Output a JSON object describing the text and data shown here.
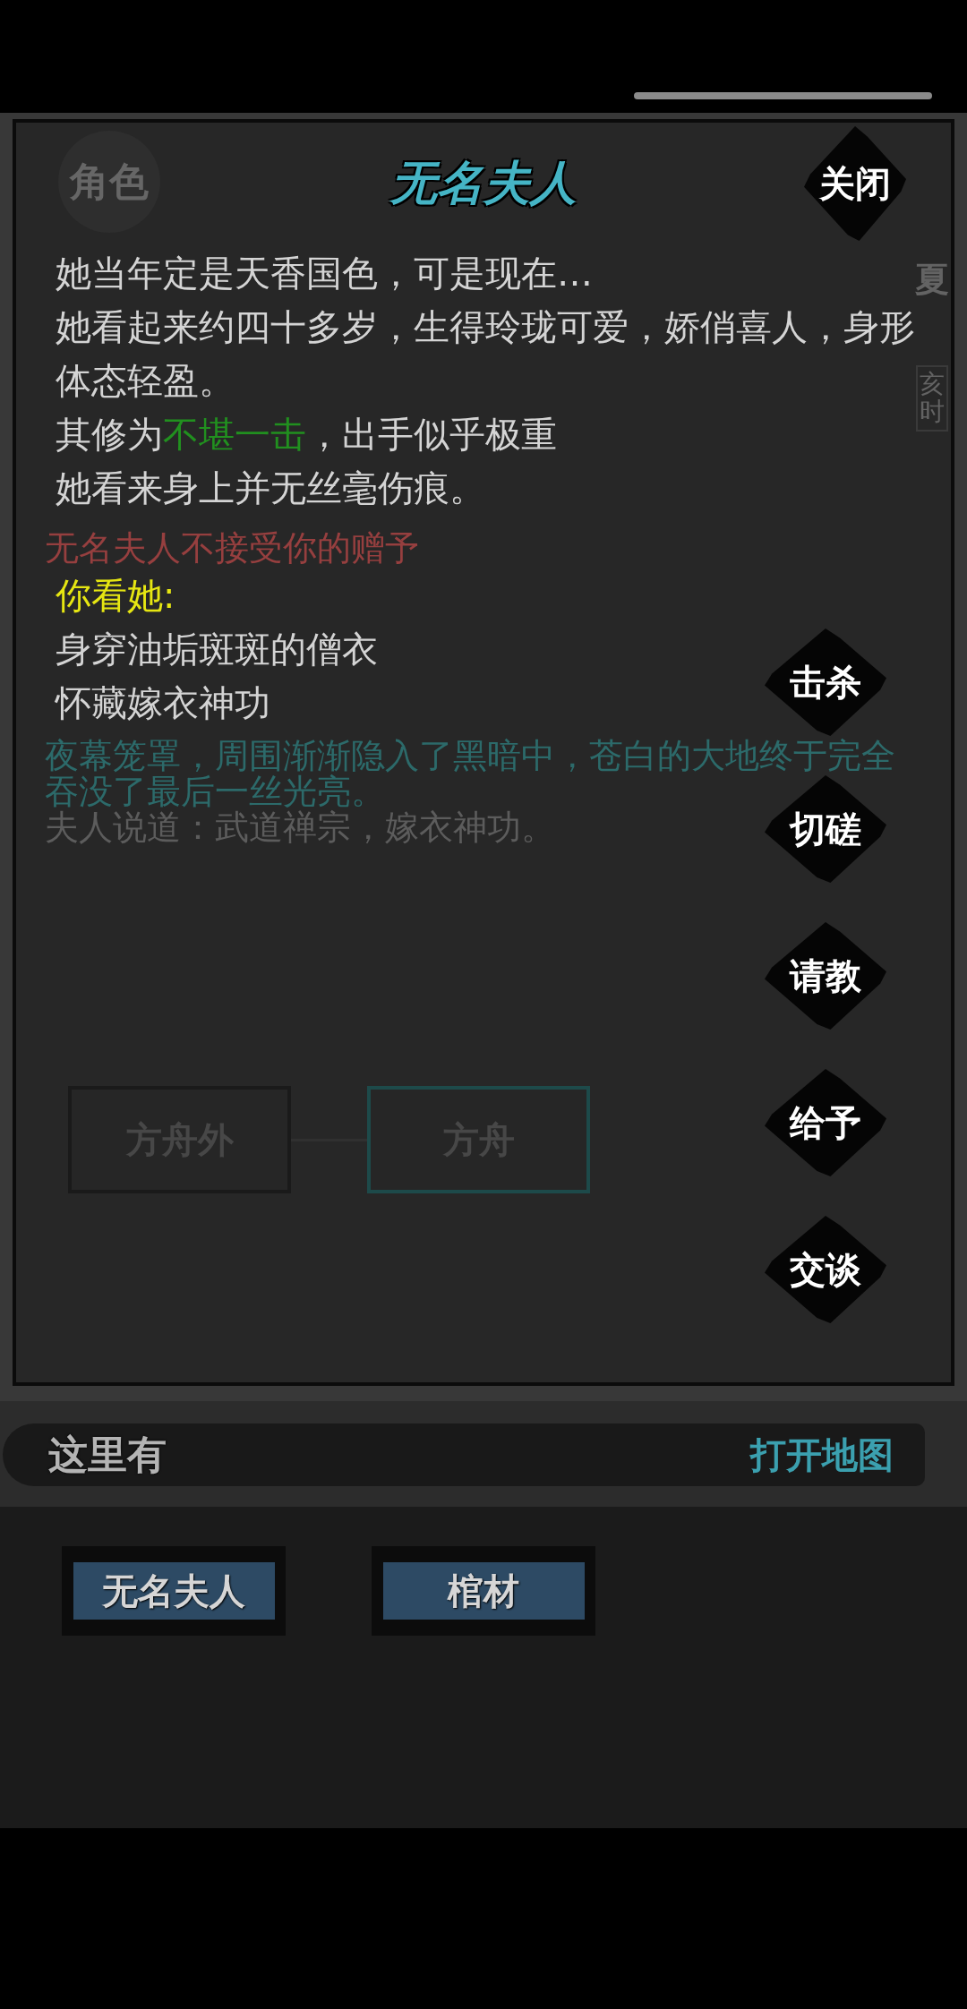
{
  "panel": {
    "tabs": [
      {
        "label": "角色"
      }
    ],
    "season": "夏",
    "time": "亥时",
    "log": [
      {
        "text": "无名夫人不接受你的赠予",
        "color": "#963f3f"
      },
      {
        "text": "夜幕笼罩，周围渐渐隐入了黑暗中，苍白的大地终于完全吞没了最后一丝光亮。",
        "color": "#2c6a6a"
      },
      {
        "text": "夫人说道：武道禅宗，嫁衣神功。",
        "color": "#5c5c5c"
      }
    ],
    "map_nodes": [
      {
        "label": "方舟外",
        "current": false
      },
      {
        "label": "方舟",
        "current": true
      }
    ]
  },
  "dialog": {
    "title": "无名夫人",
    "close": "关闭",
    "description": [
      {
        "kind": "plain",
        "text": "她当年定是天香国色，可是现在…"
      },
      {
        "kind": "plain",
        "text": "她看起来约四十多岁，生得玲珑可爱，娇俏喜人，身形体态轻盈。"
      },
      {
        "kind": "rating",
        "prefix": "其修为",
        "highlight": "不堪一击",
        "suffix": "，出手似乎极重"
      },
      {
        "kind": "plain",
        "text": "她看来身上并无丝毫伤痕。"
      }
    ],
    "observation": {
      "heading": "你看她:",
      "lines": [
        "身穿油垢斑斑的僧衣",
        "怀藏嫁衣神功"
      ]
    },
    "actions": [
      "击杀",
      "切磋",
      "请教",
      "给予",
      "交谈"
    ]
  },
  "here": {
    "label": "这里有",
    "map_link": "打开地图",
    "items": [
      "无名夫人",
      "棺材"
    ]
  }
}
